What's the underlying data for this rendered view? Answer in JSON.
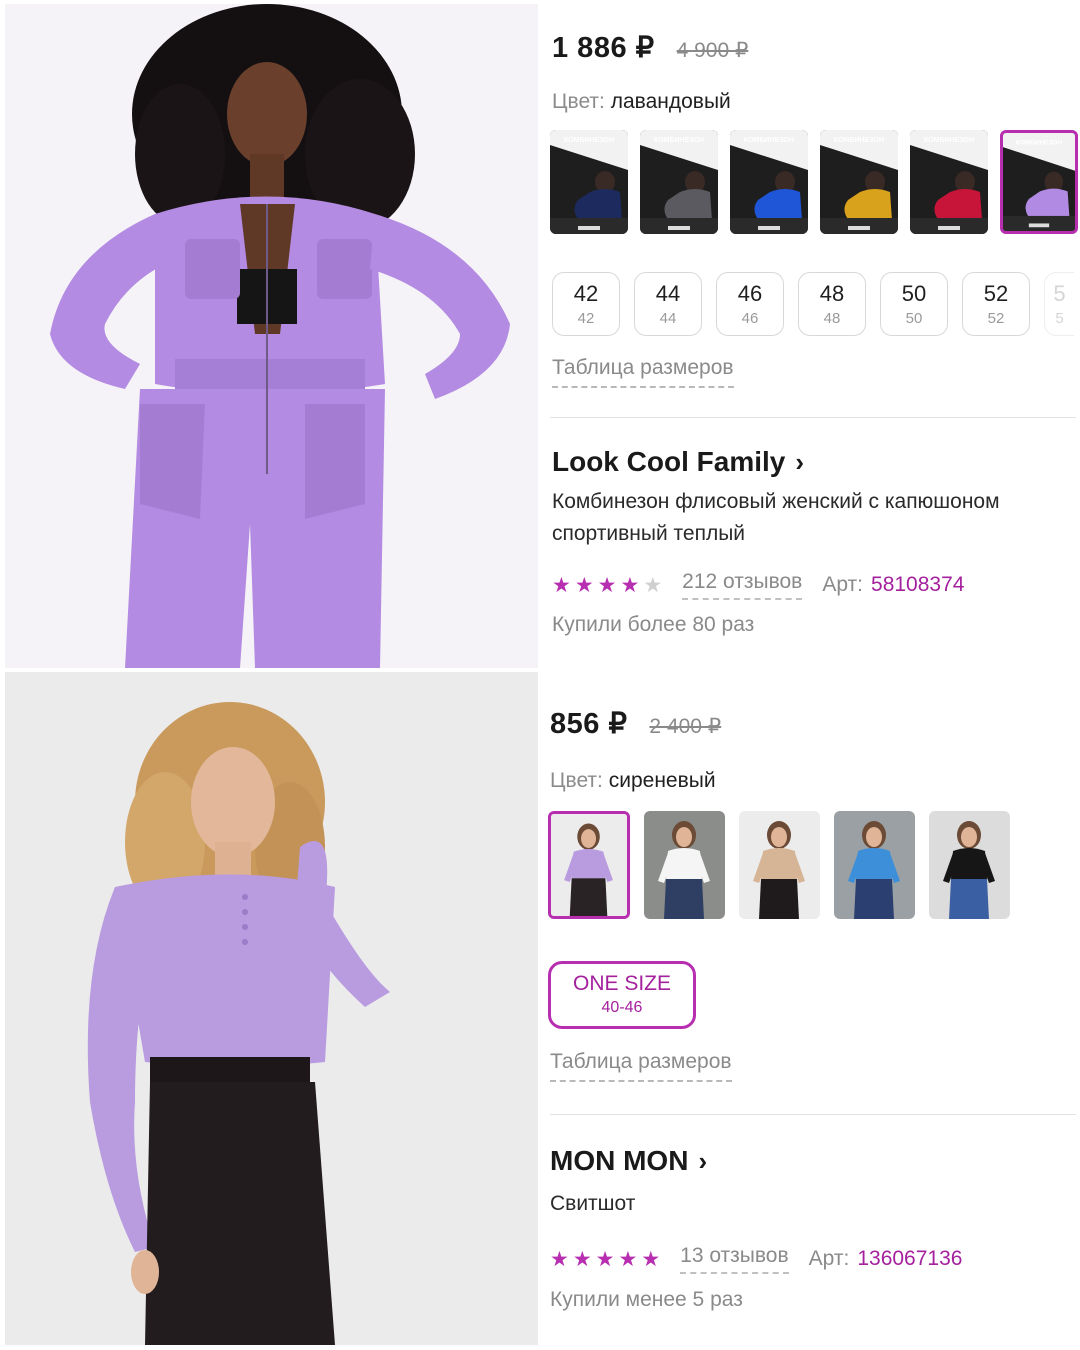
{
  "colors": {
    "accent": "#b72fb0",
    "accent_text": "#a4219d",
    "star_filled": "#b72fb0",
    "star_empty": "#cfcfcf"
  },
  "product1": {
    "price": "1 886 ₽",
    "old_price": "4 900 ₽",
    "color_label": "Цвет:",
    "color_value": "лавандовый",
    "swatches": [
      {
        "name": "navy",
        "fill": "#1d2a5e",
        "selected": false
      },
      {
        "name": "gray",
        "fill": "#5a5a60",
        "selected": false
      },
      {
        "name": "blue",
        "fill": "#1f56d8",
        "selected": false
      },
      {
        "name": "yellow",
        "fill": "#d9a21c",
        "selected": false
      },
      {
        "name": "red",
        "fill": "#c7153a",
        "selected": false
      },
      {
        "name": "lavender",
        "fill": "#b18be3",
        "selected": true
      }
    ],
    "swatch_overlay_text": "КОМБИНЕЗОН",
    "sizes": [
      {
        "ru": "42",
        "int": "42"
      },
      {
        "ru": "44",
        "int": "44"
      },
      {
        "ru": "46",
        "int": "46"
      },
      {
        "ru": "48",
        "int": "48"
      },
      {
        "ru": "50",
        "int": "50"
      },
      {
        "ru": "52",
        "int": "52"
      },
      {
        "ru": "5",
        "int": "5"
      }
    ],
    "size_table": "Таблица размеров",
    "brand": "Look Cool Family",
    "title": "Комбинезон флисовый женский с капюшоном спортивный теплый",
    "rating": 4,
    "reviews": "212 отзывов",
    "art_label": "Арт:",
    "art": "58108374",
    "bought": "Купили более 80 раз"
  },
  "product2": {
    "price": "856 ₽",
    "old_price": "2 400 ₽",
    "color_label": "Цвет:",
    "color_value": "сиреневый",
    "swatches": [
      {
        "name": "lilac",
        "top": "#b99be0",
        "bottom": "#2a2326",
        "bg": "#ececec",
        "selected": true
      },
      {
        "name": "white",
        "top": "#f5f5f5",
        "bottom": "#2f3f63",
        "bg": "#8b8d8a",
        "selected": false
      },
      {
        "name": "beige",
        "top": "#d6b597",
        "bottom": "#1f1a1c",
        "bg": "#ececec",
        "selected": false
      },
      {
        "name": "light-blue",
        "top": "#3e8fd9",
        "bottom": "#2b3f70",
        "bg": "#9aa0a3",
        "selected": false
      },
      {
        "name": "black",
        "top": "#161616",
        "bottom": "#3a5fa3",
        "bg": "#dcdcdc",
        "selected": false
      }
    ],
    "one_size_label": "ONE SIZE",
    "one_size_range": "40-46",
    "size_table": "Таблица размеров",
    "brand": "MON MON",
    "title": "Свитшот",
    "rating": 5,
    "reviews": "13 отзывов",
    "art_label": "Арт:",
    "art": "136067136",
    "bought": "Купили менее 5 раз"
  }
}
